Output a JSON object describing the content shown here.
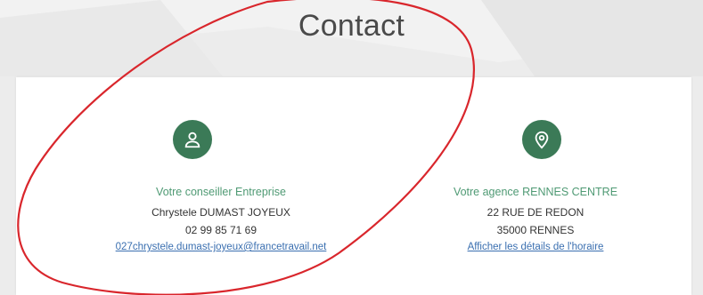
{
  "page": {
    "title": "Contact"
  },
  "advisor": {
    "icon": "user-icon",
    "label": "Votre conseiller Entreprise",
    "name": "Chrystele DUMAST JOYEUX",
    "phone": "02 99 85 71 69",
    "email": "027chrystele.dumast-joyeux@francetravail.net"
  },
  "agency": {
    "icon": "location-pin-icon",
    "label": "Votre agence RENNES CENTRE",
    "street": "22 RUE DE REDON",
    "city": "35000 RENNES",
    "hours_link": "Afficher les détails de l'horaire"
  },
  "colors": {
    "accent": "#3b7a57",
    "label_green": "#4f9a74",
    "link_blue": "#3a6fb0",
    "annotation_red": "#d9262c"
  }
}
